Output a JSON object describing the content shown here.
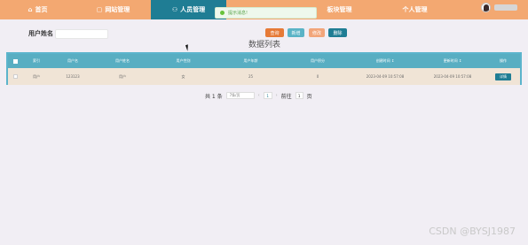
{
  "nav": {
    "items": [
      {
        "icon": "home-icon",
        "glyph": "⌂",
        "label": "首页"
      },
      {
        "icon": "grid-icon",
        "glyph": "▢",
        "label": "网站管理"
      },
      {
        "icon": "person-icon",
        "glyph": "⚇",
        "label": "人员管理"
      },
      {
        "icon": "blank",
        "glyph": "",
        "label": ""
      },
      {
        "icon": "block-icon",
        "glyph": "",
        "label": "板块管理"
      },
      {
        "icon": "blank",
        "glyph": "",
        "label": "个人管理"
      }
    ],
    "active_index": 2
  },
  "toast": {
    "text": "提示消息!"
  },
  "search": {
    "label": "用户姓名",
    "value": "",
    "placeholder": ""
  },
  "buttons": {
    "search": "查询",
    "add": "新增",
    "modify": "修改",
    "delete": "删除"
  },
  "list_title": "数据列表",
  "table": {
    "headers": [
      "",
      "索引",
      "用户名",
      "用户姓名",
      "用户性别",
      "用户年龄",
      "用户积分",
      "创建时间 ↕",
      "更新时间 ↕",
      "操作"
    ],
    "rows": [
      [
        "",
        "用户",
        "123123",
        "用户",
        "女",
        "25",
        "0",
        "2023-04-09 10:57:08",
        "2023-04-09 10:57:08",
        "详情"
      ]
    ]
  },
  "pager": {
    "total_prefix": "共 1 条",
    "page_size": "7条/页",
    "prev": "‹",
    "current": "1",
    "next": "›",
    "goto_label": "前往",
    "goto_value": "1",
    "page_suffix": "页"
  },
  "watermark": "CSDN @BYSJ1987",
  "colors": {
    "nav": "#f3a871",
    "active": "#1f7d94",
    "table_head": "#58aec2",
    "row": "#f0e4d6"
  }
}
